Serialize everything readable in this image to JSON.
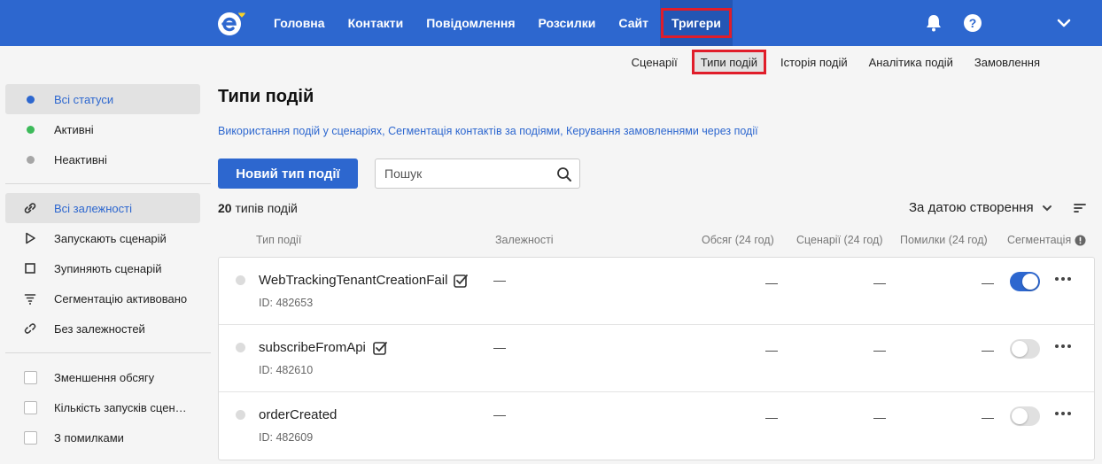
{
  "header": {
    "nav": [
      {
        "label": "Головна"
      },
      {
        "label": "Контакти"
      },
      {
        "label": "Повідомлення"
      },
      {
        "label": "Розсилки"
      },
      {
        "label": "Сайт"
      },
      {
        "label": "Тригери"
      }
    ],
    "active_nav": "Тригери"
  },
  "subnav": {
    "items": [
      {
        "label": "Сценарії"
      },
      {
        "label": "Типи подій"
      },
      {
        "label": "Історія подій"
      },
      {
        "label": "Аналітика подій"
      },
      {
        "label": "Замовлення"
      }
    ],
    "active": "Типи подій"
  },
  "sidebar": {
    "statuses": [
      {
        "label": "Всі статуси",
        "color": "#2d67cf"
      },
      {
        "label": "Активні",
        "color": "#3dba5a"
      },
      {
        "label": "Неактивні",
        "color": "#a6a6a6"
      }
    ],
    "dependencies": [
      {
        "label": "Всі залежності",
        "icon": "link-icon"
      },
      {
        "label": "Запускають сценарій",
        "icon": "play-icon"
      },
      {
        "label": "Зупиняють сценарій",
        "icon": "stop-icon"
      },
      {
        "label": "Сегментацію активовано",
        "icon": "filter-icon"
      },
      {
        "label": "Без залежностей",
        "icon": "unlink-icon"
      }
    ],
    "filters": [
      {
        "label": "Зменшення обсягу"
      },
      {
        "label": "Кількість запусків сценаріїв"
      },
      {
        "label": "З помилками"
      }
    ]
  },
  "main": {
    "title": "Типи подій",
    "links": [
      "Використання подій у сценаріях",
      "Сегментація контактів за подіями",
      "Керування замовленнями через події"
    ],
    "new_button": "Новий тип події",
    "search_placeholder": "Пошук",
    "count_number": "20",
    "count_text": "типів подій",
    "sort_label": "За датою створення",
    "columns": {
      "type": "Тип події",
      "deps": "Залежності",
      "volume": "Обсяг (24 год)",
      "scenarios": "Сценарії (24 год)",
      "errors": "Помилки (24 год)",
      "segmentation": "Сегментація"
    }
  },
  "rows": [
    {
      "name": "WebTrackingTenantCreationFail",
      "id": "ID: 482653",
      "deps": "—",
      "volume": "—",
      "scenarios": "—",
      "errors": "—",
      "segmentation": true
    },
    {
      "name": "subscribeFromApi",
      "id": "ID: 482610",
      "deps": "—",
      "volume": "—",
      "scenarios": "—",
      "errors": "—",
      "segmentation": false
    },
    {
      "name": "orderCreated",
      "id": "ID: 482609",
      "deps": "—",
      "volume": "—",
      "scenarios": "—",
      "errors": "—",
      "segmentation": false
    }
  ],
  "colors": {
    "brand": "#2d67cf",
    "highlight": "#e01d2a"
  }
}
